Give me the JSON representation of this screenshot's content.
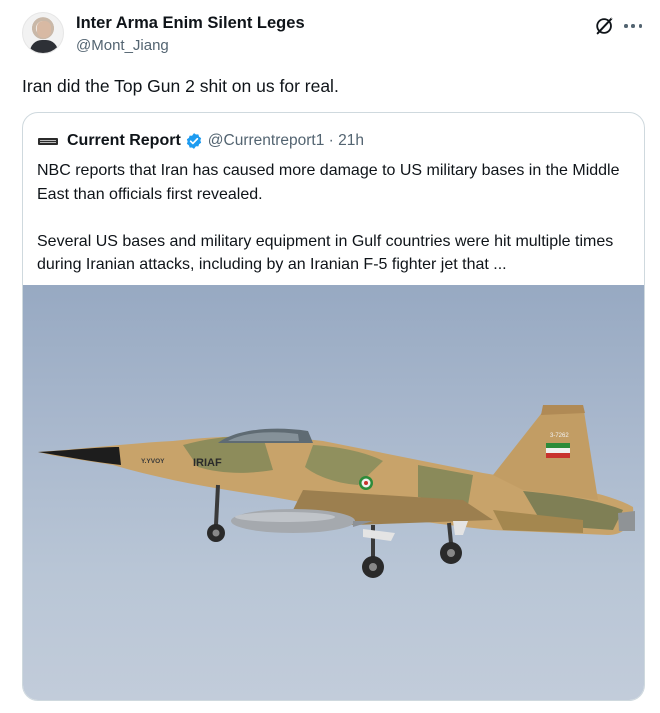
{
  "author": {
    "display_name": "Inter Arma Enim Silent Leges",
    "handle": "@Mont_Jiang",
    "avatar_icon": "person-avatar"
  },
  "tweet": {
    "text": "Iran did the Top Gun 2 shit on us for real."
  },
  "actions": {
    "grok_icon": "grok-icon",
    "more_icon": "more-dots-icon"
  },
  "quote": {
    "name": "Current Report",
    "handle_time": "@Currentreport1 · 21h",
    "verified_color": "#1d9bf0",
    "paragraph1": "NBC reports that Iran has caused more damage to US military bases in the Middle East than officials first revealed.",
    "paragraph2": "Several US bases and military equipment in Gulf countries were hit multiple times during Iranian attacks, including by an Iranian F-5 fighter jet that ...",
    "media": {
      "fuselage_text": "IRIAF",
      "nose_text": "Y.YVOY",
      "tail_text": "3-7262"
    }
  },
  "colors": {
    "text": "#0f1419",
    "secondary": "#536471",
    "border": "#cfd9de",
    "sky": "#a9b8cd",
    "camo_tan": "#c9a46a",
    "camo_green": "#8f8e5c"
  }
}
